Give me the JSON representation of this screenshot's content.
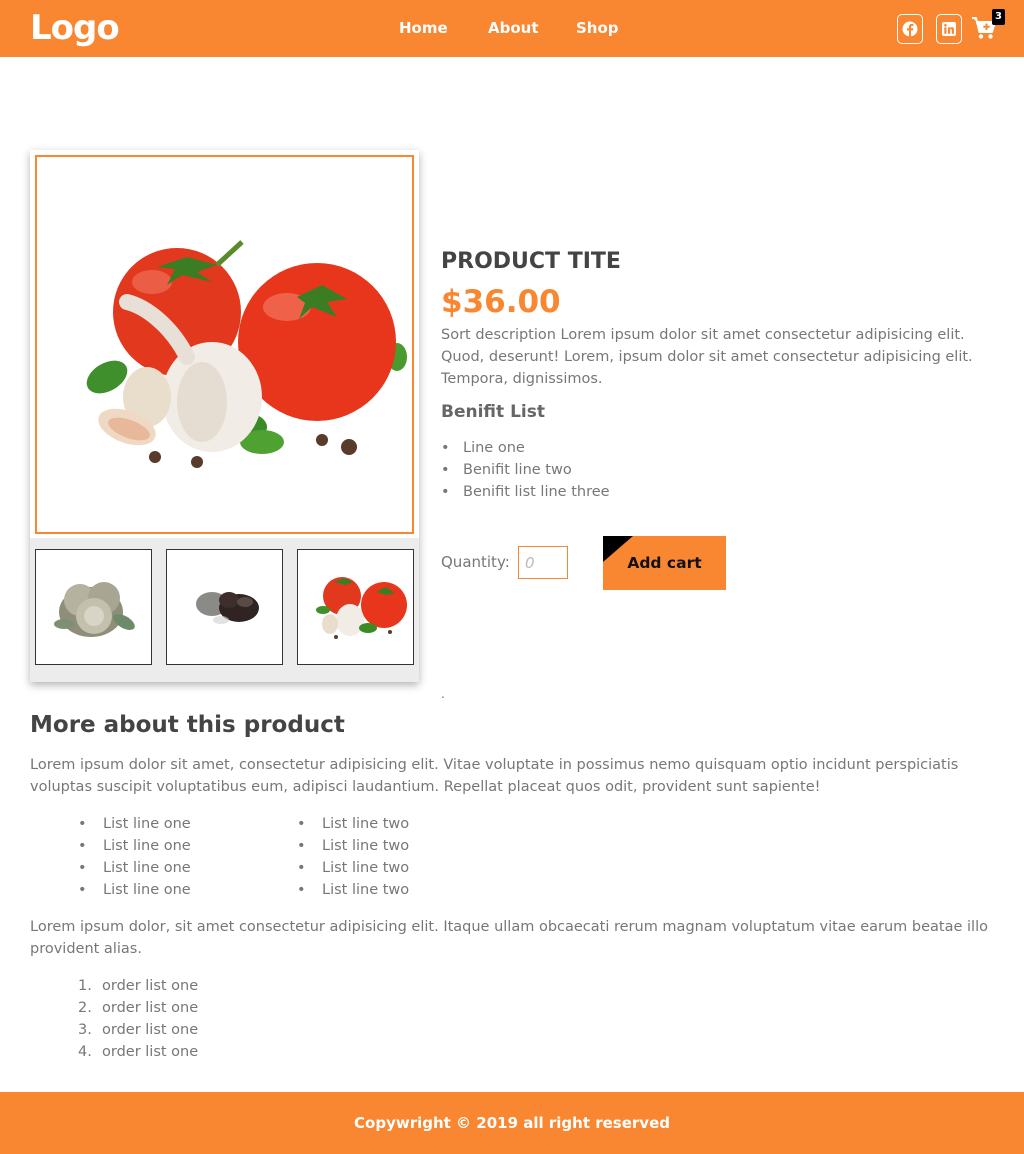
{
  "header": {
    "logo": "Logo",
    "nav": [
      "Home",
      "About",
      "Shop"
    ],
    "social_icons": [
      "facebook-icon",
      "linkedin-icon"
    ],
    "cart_icon": "cart-plus-icon",
    "cart_count": "3",
    "background": "#f98630"
  },
  "product": {
    "title": "PRODUCT TITE",
    "price": "$36.00",
    "description": "Sort description Lorem ipsum dolor sit amet consectetur adipisicing elit. Quod, deserunt! Lorem, ipsum dolor sit amet consectetur adipisicing elit. Tempora, dignissimos.",
    "benefit_heading": "Benifit List",
    "benefits": [
      "Line one",
      "Benifit line two",
      "Benifit list line three"
    ],
    "quantity_label": "Quantity:",
    "quantity_placeholder": "0",
    "add_cart_label": "Add cart",
    "dot": ".",
    "images": [
      "tomatoes-garlic-image",
      "citrus-fruit-thumbnail",
      "dark-fruit-thumbnail",
      "tomatoes-garlic-thumbnail"
    ]
  },
  "more": {
    "heading": "More about this product",
    "paragraph1": "Lorem ipsum dolor sit amet, consectetur adipisicing elit. Vitae voluptate in possimus nemo quisquam optio incidunt perspiciatis voluptas suscipit voluptatibus eum, adipisci laudantium. Repellat placeat quos odit, provident sunt sapiente!",
    "list_col1": [
      "List line one",
      "List line one",
      "List line one",
      "List line one"
    ],
    "list_col2": [
      "List line two",
      "List line two",
      "List line two",
      "List line two"
    ],
    "paragraph2": "Lorem ipsum dolor, sit amet consectetur adipisicing elit. Itaque ullam obcaecati rerum magnam voluptatum vitae earum beatae illo provident alias.",
    "ordered_numbers": [
      "1.",
      "2.",
      "3.",
      "4."
    ],
    "ordered_list": [
      "order list one",
      "order list one",
      "order list one",
      "order list one"
    ]
  },
  "footer": {
    "text": "Copywright © 2019 all right reserved"
  },
  "colors": {
    "accent": "#f98630",
    "text": "#777777",
    "heading": "#444444"
  }
}
